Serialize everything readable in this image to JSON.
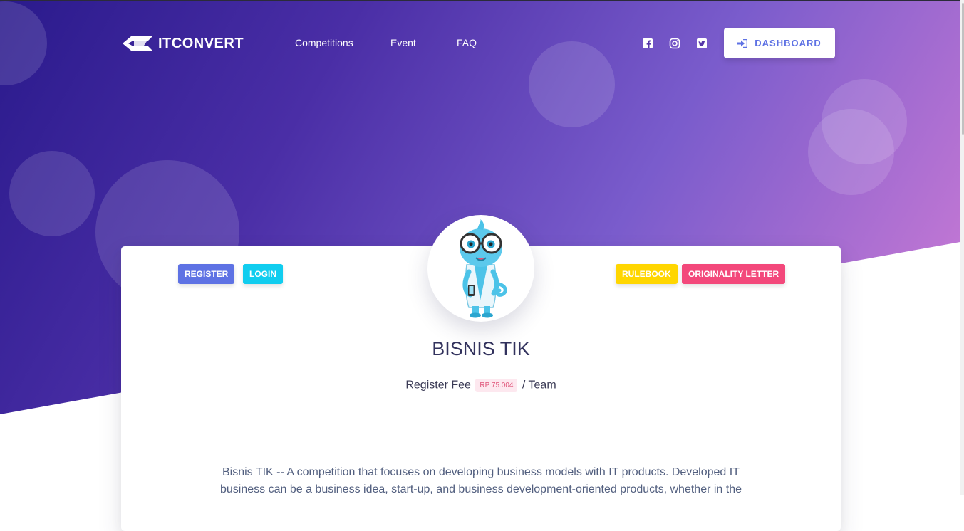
{
  "brand": {
    "name": "ITCONVERT"
  },
  "nav": {
    "links": [
      "Competitions",
      "Event",
      "FAQ"
    ]
  },
  "social": [
    "facebook-icon",
    "instagram-icon",
    "twitter-icon"
  ],
  "dashboard": {
    "label": "DASHBOARD",
    "icon": "sign-in-icon"
  },
  "card": {
    "buttons": {
      "register": "REGISTER",
      "login": "LOGIN",
      "rulebook": "RULEBOOK",
      "originality": "ORIGINALITY LETTER"
    },
    "title": "BISNIS TIK",
    "fee": {
      "label": "Register Fee",
      "amount": "RP 75.004",
      "unit": "/ Team"
    },
    "description": "Bisnis TIK -- A competition that focuses on developing business models with IT products. Developed IT business can be a business idea, start-up, and business development-oriented products, whether in the"
  },
  "colors": {
    "register": "#5e72e4",
    "login": "#11cdef",
    "rulebook": "#ffd600",
    "originality": "#f3487b"
  }
}
